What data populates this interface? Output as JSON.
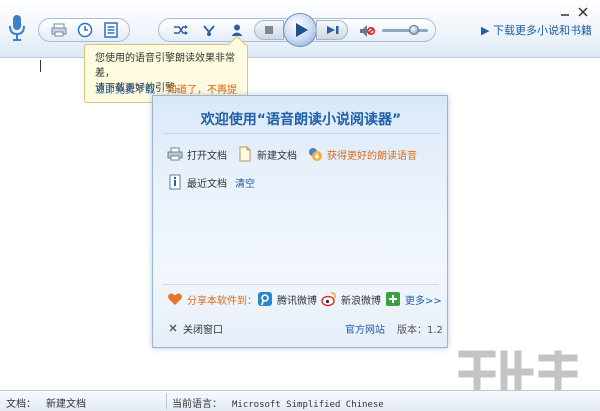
{
  "toolbar": {
    "download_link": "▶ 下载更多小说和书籍",
    "icons": [
      "microphone-icon",
      "print-icon",
      "clock-icon",
      "document-list-icon",
      "shuffle-icon",
      "voice-icon",
      "person-icon",
      "stop-icon",
      "play-icon",
      "next-icon",
      "mute-icon",
      "volume-slider",
      "minimize-icon",
      "close-icon"
    ],
    "volume_level": 0.7
  },
  "tooltip": {
    "line1": "您使用的语音引擎朗读效果非常差，",
    "line2": "请下载更好的引擎。",
    "download": "立即免费下载",
    "dismiss": "知道了，不再提醒"
  },
  "dialog": {
    "title": "欢迎使用“语音朗读小说阅读器”",
    "open_doc": "打开文档",
    "new_doc": "新建文档",
    "better_voice": "获得更好的朗读语音",
    "recent_docs": "最近文档",
    "clear": "清空",
    "share_label": "分享本软件到：",
    "tencent_weibo": "腾讯微博",
    "sina_weibo": "新浪微博",
    "more": "更多>>",
    "close": "关闭窗口",
    "official_site": "官方网站",
    "version": "版本：1.2"
  },
  "statusbar": {
    "doc_label": "文档：",
    "doc_value": "新建文档",
    "lang_label": "当前语言：",
    "lang_value": "Microsoft Simplified Chinese"
  },
  "colors": {
    "accent": "#1f5fa8",
    "link_orange": "#d96b1a",
    "dialog_bg": "#e8f1fb",
    "tooltip_bg": "#fffbe0"
  }
}
